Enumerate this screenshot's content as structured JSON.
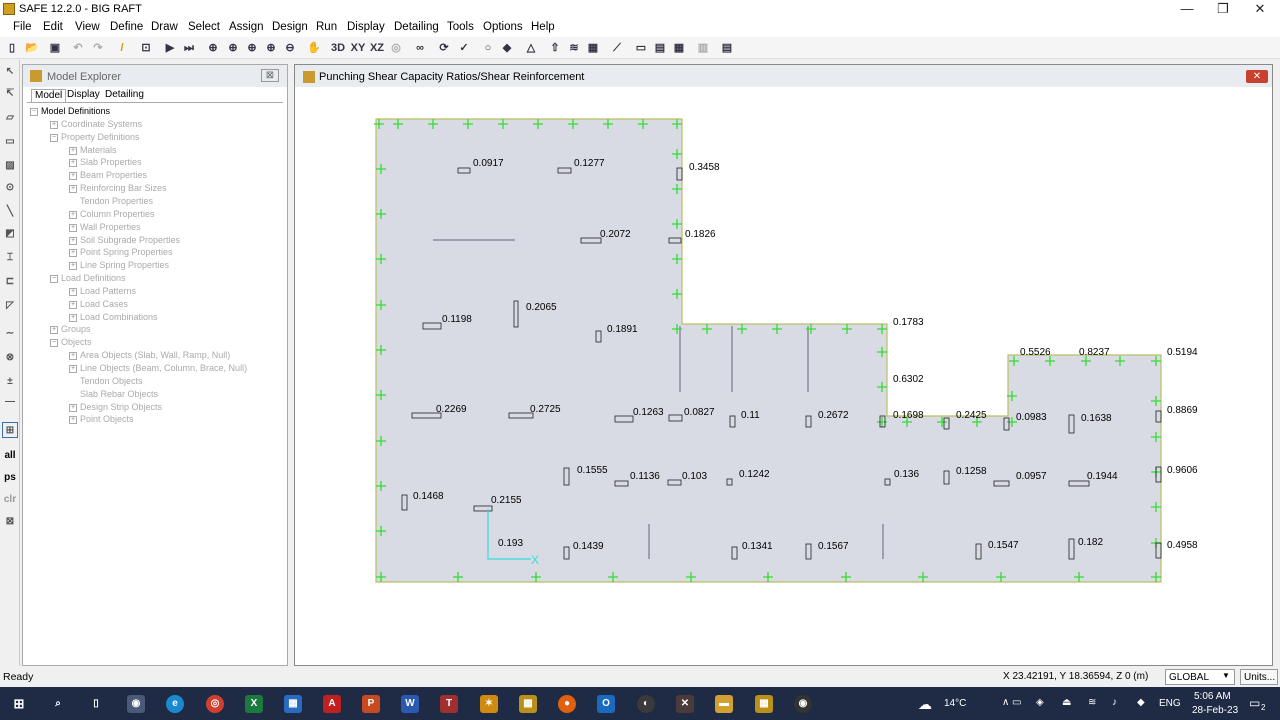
{
  "window": {
    "title": "SAFE 12.2.0 - BIG RAFT",
    "minimize": "—",
    "maximize": "❐",
    "close": "✕"
  },
  "menu": [
    "File",
    "Edit",
    "View",
    "Define",
    "Draw",
    "Select",
    "Assign",
    "Design",
    "Run",
    "Display",
    "Detailing",
    "Tools",
    "Options",
    "Help"
  ],
  "toolbar_icons": [
    "new-icon",
    "open-icon",
    "save-icon",
    "undo-icon",
    "redo-icon",
    "pencil-icon",
    "properties-icon",
    "run-icon",
    "run-all-icon",
    "zoom-window-icon",
    "zoom-restore-icon",
    "zoom-previous-icon",
    "zoom-in-icon",
    "zoom-out-icon",
    "pan-icon",
    "view-3d-icon",
    "view-xy-icon",
    "view-xz-icon",
    "view-rotate-icon",
    "glasses-icon",
    "refresh-icon",
    "check-icon",
    "circle-icon",
    "eraser-icon",
    "triangle-icon",
    "arrow-up-icon",
    "spring-icon",
    "camera-icon",
    "line-icon",
    "beam-icon",
    "strip-icon",
    "grid-icon",
    "table-icon",
    "table2-icon"
  ],
  "toolbar_labels": {
    "view3d": "3D",
    "viewxy": "XY",
    "viewxz": "XZ"
  },
  "left_tools": {
    "all": "all",
    "ps": "ps",
    "clr": "clr"
  },
  "explorer": {
    "title": "Model Explorer",
    "close": "⊠",
    "tabs": [
      "Model",
      "Display",
      "Detailing"
    ],
    "tree": [
      {
        "label": "Model Definitions",
        "level": 0,
        "dark": true,
        "box": "−"
      },
      {
        "label": "Coordinate Systems",
        "level": 1,
        "box": "+"
      },
      {
        "label": "Property Definitions",
        "level": 1,
        "box": "−"
      },
      {
        "label": "Materials",
        "level": 2,
        "box": "+"
      },
      {
        "label": "Slab Properties",
        "level": 2,
        "box": "+"
      },
      {
        "label": "Beam Properties",
        "level": 2,
        "box": "+"
      },
      {
        "label": "Reinforcing Bar Sizes",
        "level": 2,
        "box": "+"
      },
      {
        "label": "Tendon Properties",
        "level": 2,
        "box": ""
      },
      {
        "label": "Column Properties",
        "level": 2,
        "box": "+"
      },
      {
        "label": "Wall Properties",
        "level": 2,
        "box": "+"
      },
      {
        "label": "Soil Subgrade Properties",
        "level": 2,
        "box": "+"
      },
      {
        "label": "Point Spring Properties",
        "level": 2,
        "box": "+"
      },
      {
        "label": "Line Spring Properties",
        "level": 2,
        "box": "+"
      },
      {
        "label": "Load Definitions",
        "level": 1,
        "box": "−"
      },
      {
        "label": "Load Patterns",
        "level": 2,
        "box": "+"
      },
      {
        "label": "Load Cases",
        "level": 2,
        "box": "+"
      },
      {
        "label": "Load Combinations",
        "level": 2,
        "box": "+"
      },
      {
        "label": "Groups",
        "level": 1,
        "box": "+"
      },
      {
        "label": "Objects",
        "level": 1,
        "box": "−"
      },
      {
        "label": "Area Objects (Slab, Wall, Ramp, Null)",
        "level": 2,
        "box": "+"
      },
      {
        "label": "Line Objects (Beam, Column, Brace, Null)",
        "level": 2,
        "box": "+"
      },
      {
        "label": "Tendon Objects",
        "level": 2,
        "box": ""
      },
      {
        "label": "Slab Rebar Objects",
        "level": 2,
        "box": ""
      },
      {
        "label": "Design Strip Objects",
        "level": 2,
        "box": "+"
      },
      {
        "label": "Point Objects",
        "level": 2,
        "box": "+"
      }
    ]
  },
  "viewport": {
    "title": "Punching Shear Capacity Ratios/Shear Reinforcement",
    "close": "✕",
    "axis_x_label": "X",
    "ratios": [
      {
        "label": "0.0917"
      },
      {
        "label": "0.1277"
      },
      {
        "label": "0.3458"
      },
      {
        "label": "0.2072"
      },
      {
        "label": "0.1826"
      },
      {
        "label": "0.1198"
      },
      {
        "label": "0.2065"
      },
      {
        "label": "0.1891"
      },
      {
        "label": "0.1783"
      },
      {
        "label": "0.6302"
      },
      {
        "label": "0.5526"
      },
      {
        "label": "0.8237"
      },
      {
        "label": "0.5194"
      },
      {
        "label": "0.2269"
      },
      {
        "label": "0.2725"
      },
      {
        "label": "0.1263"
      },
      {
        "label": "0.0827"
      },
      {
        "label": "0.11"
      },
      {
        "label": "0.2672"
      },
      {
        "label": "0.1698"
      },
      {
        "label": "0.2425"
      },
      {
        "label": "0.0983"
      },
      {
        "label": "0.1638"
      },
      {
        "label": "0.8869"
      },
      {
        "label": "0.1555"
      },
      {
        "label": "0.1136"
      },
      {
        "label": "0.103"
      },
      {
        "label": "0.1242"
      },
      {
        "label": "0.136"
      },
      {
        "label": "0.1258"
      },
      {
        "label": "0.0957"
      },
      {
        "label": "0.1944"
      },
      {
        "label": "0.9606"
      },
      {
        "label": "0.1468"
      },
      {
        "label": "0.2155"
      },
      {
        "label": "0.193"
      },
      {
        "label": "0.1439"
      },
      {
        "label": "0.1341"
      },
      {
        "label": "0.1567"
      },
      {
        "label": "0.1547"
      },
      {
        "label": "0.182"
      },
      {
        "label": "0.4958"
      }
    ]
  },
  "status": {
    "ready": "Ready",
    "coords": "X 23.42191,  Y 18.36594,  Z 0  (m)",
    "coord_system": "GLOBAL",
    "units": "Units..."
  },
  "taskbar": {
    "weather": "14°C",
    "lang": "ENG",
    "time": "5:06 AM",
    "date": "28-Feb-23",
    "notifications": "2",
    "apps": [
      "start-icon",
      "search-icon",
      "task-view-icon",
      "camera-app-icon",
      "edge-icon",
      "chrome-icon",
      "excel-icon",
      "store-icon",
      "acrobat-icon",
      "powerpoint-icon",
      "word-icon",
      "teamviewer-icon",
      "app-yellow-icon",
      "safe-icon",
      "firefox-icon",
      "outlook-icon",
      "app-circle-icon",
      "app-dark-icon",
      "explorer-icon",
      "safe2-icon",
      "obs-icon"
    ]
  },
  "colors": {
    "slab_fill": "#d8dbe3",
    "slab_edge": "#b8c060",
    "column_mark": "#33dd33",
    "axis": "#33dddd",
    "taskbar": "#1f2b45"
  }
}
